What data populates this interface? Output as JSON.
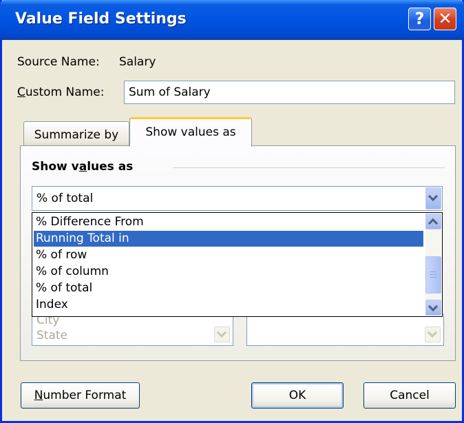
{
  "window": {
    "title": "Value Field Settings",
    "help_button": "?",
    "close_button": "✕"
  },
  "source": {
    "label": "Source Name:",
    "value": "Salary"
  },
  "custom_name": {
    "label_underlined": "C",
    "label_rest": "ustom Name:",
    "value": "Sum of Salary"
  },
  "tabs": [
    {
      "label": "Summarize by",
      "active": false
    },
    {
      "label": "Show values as",
      "active": true
    }
  ],
  "show_values": {
    "heading_pre": "Show v",
    "heading_underlined": "a",
    "heading_post": "lues as",
    "selected_value": "% of total",
    "options": [
      "% Difference From",
      "Running Total in",
      "% of row",
      "% of column",
      "% of total",
      "Index"
    ],
    "highlighted_option": "Running Total in"
  },
  "base_field": {
    "items": [
      "City",
      "State"
    ]
  },
  "buttons": {
    "number_format_underlined": "N",
    "number_format_rest": "umber Format",
    "ok": "OK",
    "cancel": "Cancel"
  },
  "colors": {
    "title_bar": "#0054e3",
    "dialog_face": "#ece9d8",
    "selection": "#316ac5",
    "active_tab_accent": "#ffc83c",
    "close_button": "#d2401e"
  }
}
